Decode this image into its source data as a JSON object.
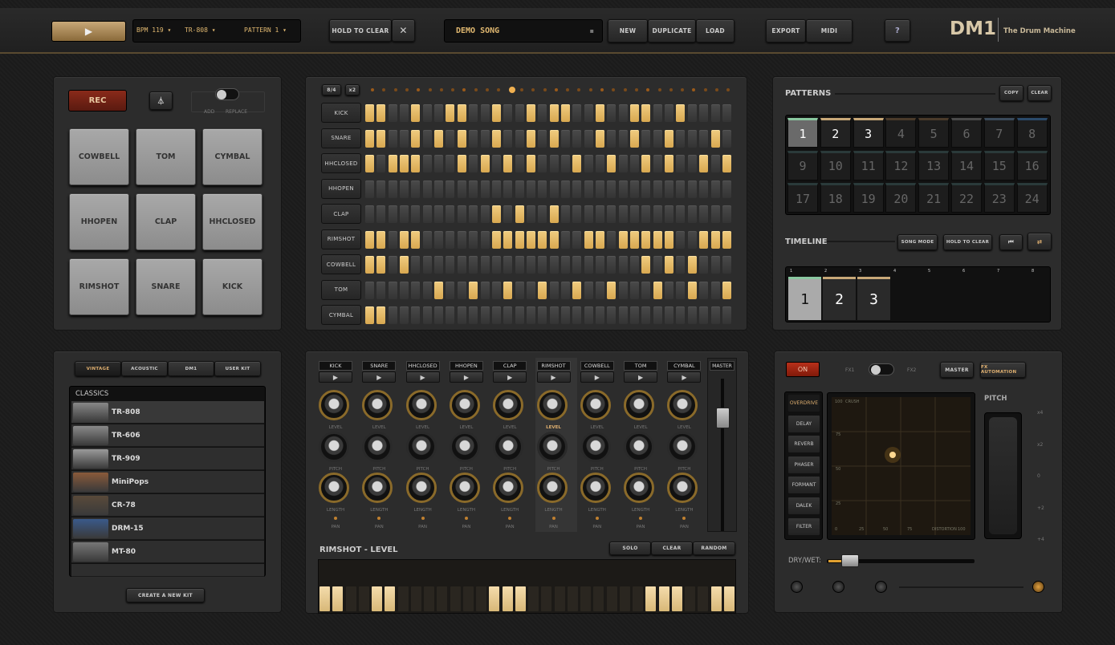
{
  "toolbar": {
    "bpm": "BPM 119",
    "kit": "TR-808",
    "pattern": "PATTERN 1",
    "hold_to_clear": "HOLD TO CLEAR",
    "song_name": "DEMO SONG",
    "new": "NEW",
    "duplicate": "DUPLICATE",
    "load": "LOAD",
    "export": "EXPORT",
    "midi": "MIDI",
    "help": "?"
  },
  "brand": {
    "logo": "DM1",
    "tagline": "The Drum Machine"
  },
  "pads_panel": {
    "rec": "REC",
    "add": "ADD",
    "replace": "REPLACE",
    "pads": [
      "COWBELL",
      "TOM",
      "CYMBAL",
      "HHOPEN",
      "CLAP",
      "HHCLOSED",
      "RIMSHOT",
      "SNARE",
      "KICK"
    ]
  },
  "sequencer": {
    "btn_8_4": "8/4",
    "btn_x2": "x2",
    "tracks": [
      {
        "name": "KICK",
        "steps": [
          1,
          1,
          0,
          0,
          1,
          0,
          0,
          1,
          1,
          0,
          0,
          1,
          0,
          0,
          1,
          0,
          1,
          1,
          0,
          0,
          1,
          0,
          0,
          1,
          1,
          0,
          0,
          1,
          0,
          0,
          0,
          0
        ]
      },
      {
        "name": "SNARE",
        "steps": [
          1,
          1,
          0,
          0,
          1,
          0,
          1,
          0,
          1,
          0,
          0,
          1,
          0,
          0,
          1,
          0,
          1,
          0,
          0,
          0,
          1,
          0,
          0,
          1,
          0,
          0,
          1,
          0,
          0,
          0,
          1,
          0
        ]
      },
      {
        "name": "HHCLOSED",
        "steps": [
          1,
          0,
          1,
          1,
          1,
          0,
          0,
          0,
          1,
          0,
          1,
          0,
          1,
          0,
          1,
          0,
          0,
          0,
          1,
          0,
          0,
          1,
          0,
          0,
          1,
          0,
          1,
          0,
          0,
          1,
          0,
          1
        ]
      },
      {
        "name": "HHOPEN",
        "steps": [
          0,
          0,
          0,
          0,
          0,
          0,
          0,
          0,
          0,
          0,
          0,
          0,
          0,
          0,
          0,
          0,
          0,
          0,
          0,
          0,
          0,
          0,
          0,
          0,
          0,
          0,
          0,
          0,
          0,
          0,
          0,
          0
        ]
      },
      {
        "name": "CLAP",
        "steps": [
          0,
          0,
          0,
          0,
          0,
          0,
          0,
          0,
          0,
          0,
          0,
          1,
          0,
          1,
          0,
          0,
          1,
          0,
          0,
          0,
          0,
          0,
          0,
          0,
          0,
          0,
          0,
          0,
          0,
          0,
          0,
          0
        ]
      },
      {
        "name": "RIMSHOT",
        "steps": [
          1,
          1,
          0,
          1,
          1,
          0,
          0,
          0,
          0,
          0,
          0,
          1,
          1,
          1,
          1,
          1,
          1,
          0,
          0,
          1,
          1,
          0,
          1,
          1,
          1,
          1,
          1,
          0,
          0,
          1,
          1,
          1
        ]
      },
      {
        "name": "COWBELL",
        "steps": [
          1,
          1,
          0,
          1,
          0,
          0,
          0,
          0,
          0,
          0,
          0,
          0,
          0,
          0,
          0,
          0,
          0,
          0,
          0,
          0,
          0,
          0,
          0,
          0,
          1,
          0,
          1,
          0,
          1,
          0,
          0,
          0
        ]
      },
      {
        "name": "TOM",
        "steps": [
          0,
          0,
          0,
          0,
          0,
          0,
          1,
          0,
          0,
          1,
          0,
          0,
          1,
          0,
          0,
          1,
          0,
          0,
          1,
          0,
          0,
          1,
          0,
          0,
          0,
          1,
          0,
          0,
          1,
          0,
          0,
          1
        ]
      },
      {
        "name": "CYMBAL",
        "steps": [
          1,
          1,
          0,
          0,
          0,
          0,
          0,
          0,
          0,
          0,
          0,
          0,
          0,
          0,
          0,
          0,
          0,
          0,
          0,
          0,
          0,
          0,
          0,
          0,
          0,
          0,
          0,
          0,
          0,
          0,
          0,
          0
        ]
      }
    ]
  },
  "patterns": {
    "title": "PATTERNS",
    "copy": "COPY",
    "clear": "CLEAR",
    "cells": [
      "1",
      "2",
      "3",
      "4",
      "5",
      "6",
      "7",
      "8",
      "9",
      "10",
      "11",
      "12",
      "13",
      "14",
      "15",
      "16",
      "17",
      "18",
      "19",
      "20",
      "21",
      "22",
      "23",
      "24"
    ]
  },
  "timeline": {
    "title": "TIMELINE",
    "song_mode": "SONG MODE",
    "hold_to_clear": "HOLD TO CLEAR",
    "ruler": [
      "1",
      "2",
      "3",
      "4",
      "5",
      "6",
      "7",
      "8"
    ],
    "blocks": [
      "1",
      "2",
      "3"
    ]
  },
  "kits": {
    "tabs": [
      "VINTAGE",
      "ACOUSTIC",
      "DM1",
      "USER KIT"
    ],
    "header": "CLASSICS",
    "items": [
      "TR-808",
      "TR-606",
      "TR-909",
      "MiniPops",
      "CR-78",
      "DRM-15",
      "MT-80"
    ],
    "create": "CREATE A NEW KIT"
  },
  "mixer": {
    "channels": [
      "KICK",
      "SNARE",
      "HHCLOSED",
      "HHOPEN",
      "CLAP",
      "RIMSHOT",
      "COWBELL",
      "TOM",
      "CYMBAL"
    ],
    "master": "MASTER",
    "level": "LEVEL",
    "pitch": "PITCH",
    "length": "LENGTH",
    "pan": "PAN"
  },
  "editor": {
    "title": "RIMSHOT - LEVEL",
    "solo": "SOLO",
    "clear": "CLEAR",
    "random": "RANDOM",
    "keys_on": [
      1,
      1,
      0,
      0,
      1,
      1,
      0,
      0,
      0,
      0,
      0,
      0,
      0,
      1,
      1,
      1,
      0,
      0,
      0,
      0,
      0,
      0,
      0,
      0,
      0,
      1,
      1,
      1,
      0,
      0,
      1,
      1
    ]
  },
  "fx": {
    "on": "ON",
    "fx1": "FX1",
    "fx2": "FX2",
    "master": "MASTER",
    "automation": "FX AUTOMATION",
    "effects": [
      "OVERDRIVE",
      "DELAY",
      "REVERB",
      "PHASER",
      "FORMANT",
      "DALEK",
      "FILTER"
    ],
    "pad_corner": "100",
    "pad_y_label": "CRUSH",
    "pad_x_label": "DISTORTION",
    "y_ticks": [
      "75",
      "50",
      "25"
    ],
    "x_ticks": [
      "0",
      "25",
      "50",
      "75",
      "100"
    ],
    "pitch": "PITCH",
    "pitch_marks": [
      "x4",
      "x2",
      "0",
      "+2",
      "+4"
    ],
    "drywet": "DRY/WET:"
  }
}
